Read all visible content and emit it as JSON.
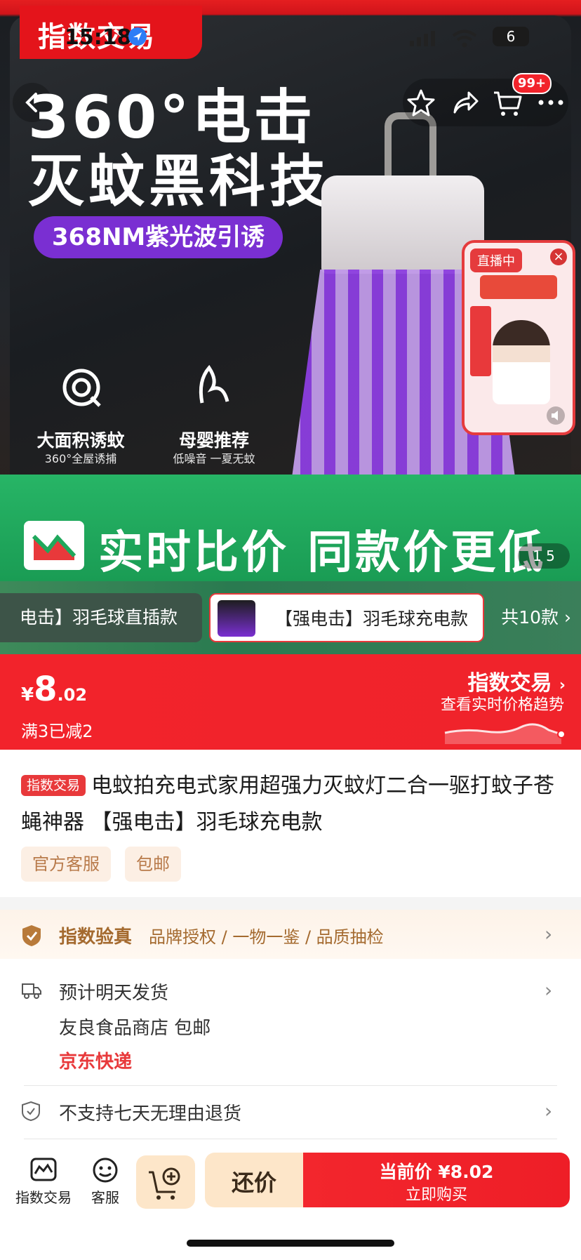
{
  "status_bar": {
    "time": "15:18",
    "battery": "6"
  },
  "hero": {
    "brand_tag": "指数交易",
    "headline_line1": "360°电击",
    "headline_line2": "灭蚊黑科技",
    "pill": "368NM紫光波引诱",
    "features": [
      {
        "icon": "target-icon",
        "title": "大面积诱蚊",
        "sub": "360°全屋诱捕"
      },
      {
        "icon": "leaf-icon",
        "title": "母婴推荐",
        "sub": "低噪音 一夏无蚊"
      }
    ],
    "cart_badge": "99+",
    "live": {
      "tag": "直播中"
    },
    "green_banner": "实时比价 同款价更低",
    "page_counter": "1 5"
  },
  "variants": {
    "prev_chip": "电击】羽毛球直插款",
    "active_chip": "【强电击】羽毛球充电款",
    "total": "共10款"
  },
  "price": {
    "currency": "¥",
    "integer": "8",
    "decimal": ".02",
    "promo": "满3已减2",
    "exchange_title": "指数交易",
    "exchange_sub": "查看实时价格趋势"
  },
  "product": {
    "badge": "指数交易",
    "title": "电蚊拍充电式家用超强力灭蚊灯二合一驱打蚊子苍蝇神器 【强电击】羽毛球充电款",
    "tags": [
      "官方客服",
      "包邮"
    ]
  },
  "auth": {
    "title": "指数验真",
    "desc": "品牌授权 / 一物一鉴 / 品质抽检"
  },
  "delivery": {
    "line1": "预计明天发货",
    "line2": "友良食品商店 包邮",
    "line3": "京东快递"
  },
  "returns": {
    "text": "不支持七天无理由退货"
  },
  "bottom_bar": {
    "exchange_label": "指数交易",
    "service_label": "客服",
    "haggle": "还价",
    "buy_line1": "当前价 ¥8.02",
    "buy_line2": "立即购买"
  },
  "colors": {
    "accent_red": "#f2232b",
    "green": "#1fa85c",
    "gold": "#a46a2f"
  }
}
